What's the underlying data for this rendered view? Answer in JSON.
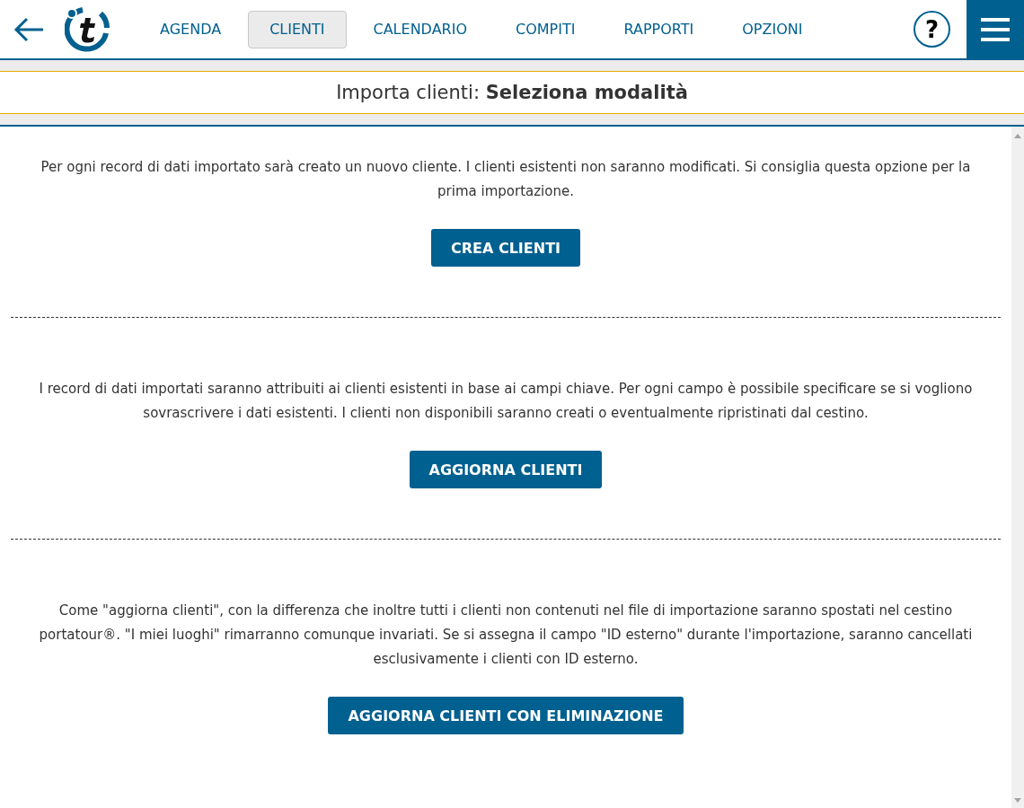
{
  "nav": {
    "tabs": [
      {
        "label": "AGENDA",
        "selected": false
      },
      {
        "label": "CLIENTI",
        "selected": true
      },
      {
        "label": "CALENDARIO",
        "selected": false
      },
      {
        "label": "COMPITI",
        "selected": false
      },
      {
        "label": "RAPPORTI",
        "selected": false
      },
      {
        "label": "OPZIONI",
        "selected": false
      }
    ],
    "help": "?"
  },
  "title": "Importa clienti: **Seleziona modalità**",
  "sections": [
    {
      "text": "Per ogni record di dati importato sarà creato un nuovo cliente. I clienti esistenti non saranno modificati. Si consiglia questa opzione per la prima importazione.",
      "button": "CREA CLIENTI"
    },
    {
      "text": "I record di dati importati saranno attribuiti ai clienti esistenti in base ai campi chiave. Per ogni campo è possibile specificare se si vogliono sovrascrivere i dati esistenti. I clienti non disponibili saranno creati o eventualmente ripristinati dal cestino.",
      "button": "AGGIORNA CLIENTI"
    },
    {
      "text": "Come \"aggiorna clienti\", con la differenza che inoltre tutti i clienti non contenuti nel file di importazione saranno spostati nel cestino portatour®. \"I miei luoghi\" rimarranno comunque invariati. Se si assegna il campo \"ID esterno\" durante l'importazione, saranno cancellati esclusivamente i clienti con ID esterno.",
      "button": "AGGIORNA CLIENTI CON ELIMINAZIONE"
    }
  ]
}
